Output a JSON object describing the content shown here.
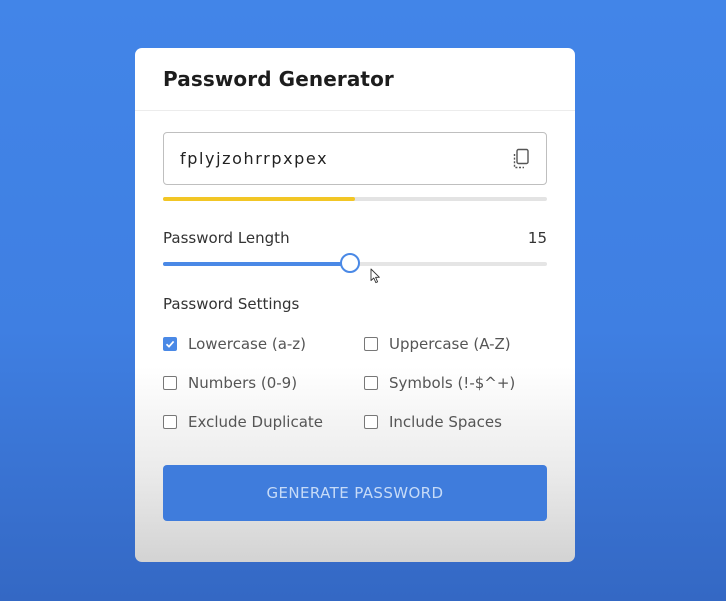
{
  "app": {
    "title": "Password Generator"
  },
  "password": {
    "value": "fplyjzohrrpxpex",
    "copy_icon": "copy-icon",
    "strength_fraction": 0.5,
    "strength_color": "#f2c625"
  },
  "length": {
    "label": "Password Length",
    "value": "15",
    "slider_fraction": 0.485,
    "accent_color": "#4a89e6"
  },
  "settings": {
    "title": "Password Settings",
    "options": [
      {
        "label": "Lowercase (a-z)",
        "checked": true
      },
      {
        "label": "Uppercase (A-Z)",
        "checked": false
      },
      {
        "label": "Numbers (0-9)",
        "checked": false
      },
      {
        "label": "Symbols (!-$^+)",
        "checked": false
      },
      {
        "label": "Exclude Duplicate",
        "checked": false
      },
      {
        "label": "Include Spaces",
        "checked": false
      }
    ]
  },
  "generate_button": {
    "label": "GENERATE PASSWORD",
    "color": "#3f7cdc"
  }
}
